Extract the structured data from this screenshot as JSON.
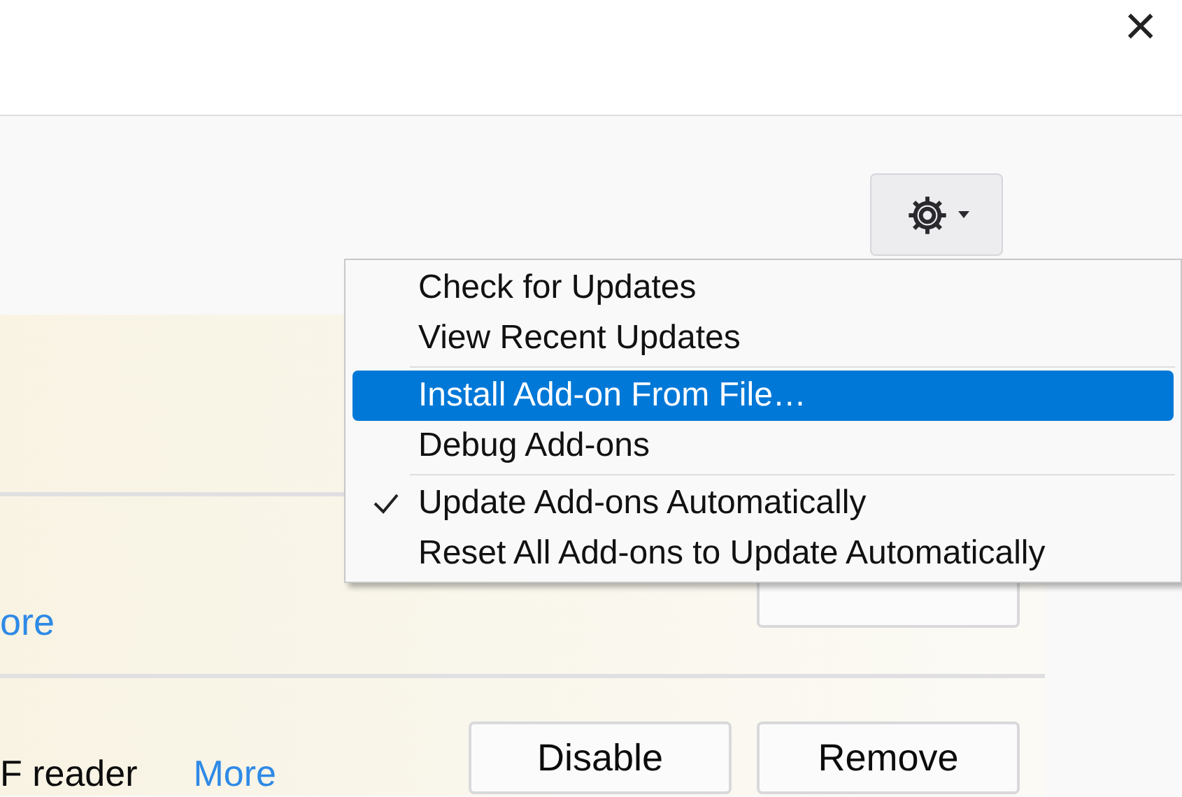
{
  "header": {
    "close": "×"
  },
  "tools_menu": {
    "open": true,
    "items": [
      {
        "kind": "item",
        "label": "Check for Updates",
        "selected": false,
        "checked": false
      },
      {
        "kind": "item",
        "label": "View Recent Updates",
        "selected": false,
        "checked": false
      },
      {
        "kind": "separator"
      },
      {
        "kind": "item",
        "label": "Install Add-on From File…",
        "selected": true,
        "checked": false
      },
      {
        "kind": "item",
        "label": "Debug Add-ons",
        "selected": false,
        "checked": false
      },
      {
        "kind": "separator"
      },
      {
        "kind": "item",
        "label": "Update Add-ons Automatically",
        "selected": false,
        "checked": true
      },
      {
        "kind": "item",
        "label": "Reset All Add-ons to Update Automatically",
        "selected": false,
        "checked": false
      }
    ]
  },
  "addons": [
    {
      "kind": "blank"
    },
    {
      "link": "ore",
      "covered_button": true
    },
    {
      "description": "F reader",
      "link": "More",
      "buttons": [
        "Disable",
        "Remove"
      ]
    }
  ]
}
